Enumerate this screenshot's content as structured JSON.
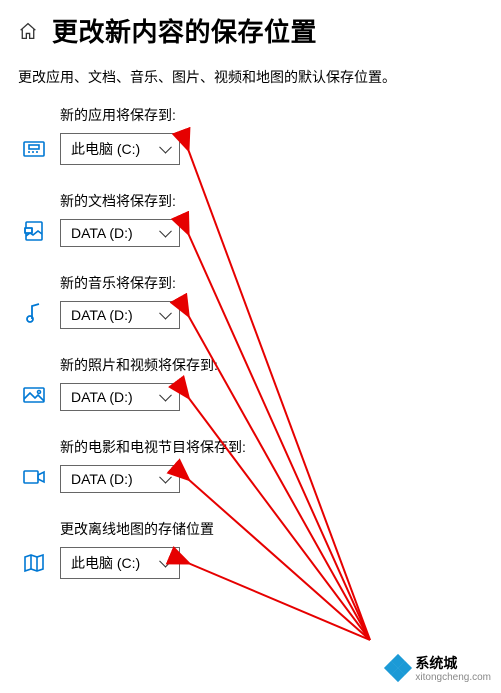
{
  "title": "更改新内容的保存位置",
  "subtitle": "更改应用、文档、音乐、图片、视频和地图的默认保存位置。",
  "drive_pc": "此电脑 (C:)",
  "drive_data": "DATA (D:)",
  "rows": [
    {
      "label": "新的应用将保存到:",
      "value_key": "drive_pc",
      "icon": "apps"
    },
    {
      "label": "新的文档将保存到:",
      "value_key": "drive_data",
      "icon": "docs"
    },
    {
      "label": "新的音乐将保存到:",
      "value_key": "drive_data",
      "icon": "music"
    },
    {
      "label": "新的照片和视频将保存到:",
      "value_key": "drive_data",
      "icon": "photos"
    },
    {
      "label": "新的电影和电视节目将保存到:",
      "value_key": "drive_data",
      "icon": "movies"
    },
    {
      "label": "更改离线地图的存储位置",
      "value_key": "drive_pc",
      "icon": "maps"
    }
  ],
  "watermark": {
    "brand": "系统城",
    "url": "xitongcheng.com"
  }
}
